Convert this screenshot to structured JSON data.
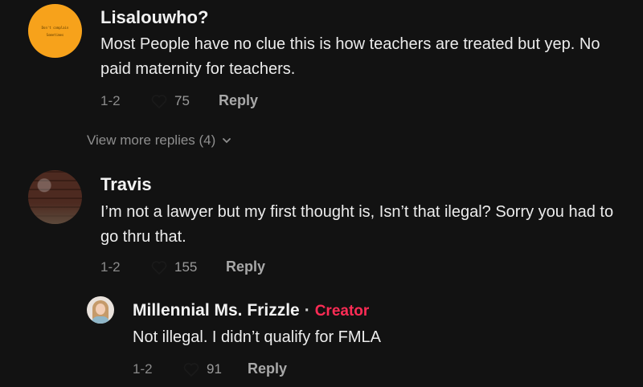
{
  "comments": [
    {
      "username": "Lisalouwho?",
      "avatar_text": [
        "Don't complain",
        "Sometimes"
      ],
      "text": "Most People have no clue this is how teachers are treated but yep. No paid maternity for teachers.",
      "date": "1-2",
      "likes": "75",
      "reply_label": "Reply"
    },
    {
      "username": "Travis",
      "text": "I’m not a lawyer but my first thought is, Isn’t that ilegal? Sorry you had to go thru that.",
      "date": "1-2",
      "likes": "155",
      "reply_label": "Reply"
    }
  ],
  "view_more": "View more replies (4)",
  "reply": {
    "username": "Millennial Ms. Frizzle",
    "separator": "·",
    "badge": "Creator",
    "text": "Not illegal. I didn’t qualify for FMLA",
    "date": "1-2",
    "likes": "91",
    "reply_label": "Reply"
  },
  "colors": {
    "background": "#121212",
    "creator_badge": "#fe2c55",
    "avatar_orange": "#f7a21b"
  },
  "icons": [
    "heart-icon",
    "chevron-down-icon"
  ]
}
